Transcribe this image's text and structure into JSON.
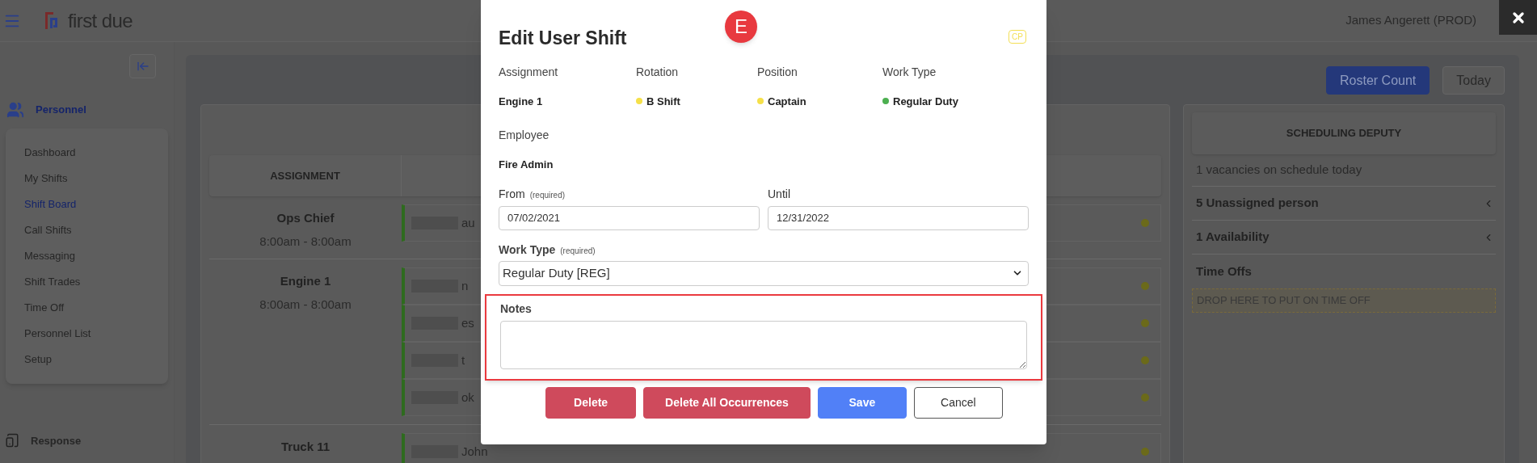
{
  "header": {
    "logo_text": "first due",
    "user_name": "James Angerett (PROD)"
  },
  "sidebar": {
    "section": "Personnel",
    "items": [
      {
        "label": "Dashboard",
        "selected": false
      },
      {
        "label": "My Shifts",
        "selected": false
      },
      {
        "label": "Shift Board",
        "selected": true
      },
      {
        "label": "Call Shifts",
        "selected": false
      },
      {
        "label": "Messaging",
        "selected": false
      },
      {
        "label": "Shift Trades",
        "selected": false
      },
      {
        "label": "Time Off",
        "selected": false
      },
      {
        "label": "Personnel List",
        "selected": false
      },
      {
        "label": "Setup",
        "selected": false
      }
    ],
    "footer_section": "Response"
  },
  "toolbar": [
    {
      "label": "Roster Count",
      "kind": "primary"
    },
    {
      "label": "Today",
      "kind": "outline"
    }
  ],
  "board": {
    "column_1": "ASSIGNMENT",
    "rows": [
      {
        "assignment": "Ops Chief",
        "time": "8:00am - 8:00am",
        "people": [
          "au"
        ]
      },
      {
        "assignment": "Engine 1",
        "time": "8:00am - 8:00am",
        "people": [
          "n",
          "es",
          "t",
          "ok"
        ]
      },
      {
        "assignment": "Truck 11",
        "people": [
          "John"
        ]
      }
    ]
  },
  "deputy": {
    "title": "SCHEDULING DEPUTY",
    "summary": "1 vacancies on schedule today",
    "sections": [
      {
        "label": "5 Unassigned person",
        "expandable": true
      },
      {
        "label": "1 Availability",
        "expandable": true
      },
      {
        "label": "Time Offs",
        "expandable": false
      }
    ],
    "drop_zone": "DROP HERE TO PUT ON TIME OFF"
  },
  "modal": {
    "badge": "E",
    "title": "Edit User Shift",
    "tag": "CP",
    "info": [
      {
        "label": "Assignment",
        "value": "Engine 1"
      },
      {
        "label": "Rotation",
        "value": "B Shift",
        "color": "#f5e04a"
      },
      {
        "label": "Position",
        "value": "Captain",
        "color": "#f5e04a"
      },
      {
        "label": "Work Type",
        "value": "Regular Duty",
        "color": "#4caf50"
      }
    ],
    "employee": {
      "label": "Employee",
      "value": "Fire Admin"
    },
    "dates": [
      {
        "label": "From",
        "hint": "(required)",
        "value": "07/02/2021"
      },
      {
        "label": "Until",
        "value": "12/31/2022"
      }
    ],
    "work_type": {
      "label": "Work Type",
      "hint": "(required)",
      "value": "Regular Duty [REG]"
    },
    "notes": {
      "label": "Notes",
      "highlighted": true
    },
    "buttons": [
      {
        "label": "Delete",
        "kind": "danger"
      },
      {
        "label": "Delete All Occurrences",
        "kind": "danger"
      },
      {
        "label": "Save",
        "kind": "primary"
      },
      {
        "label": "Cancel",
        "kind": "outline"
      }
    ]
  }
}
